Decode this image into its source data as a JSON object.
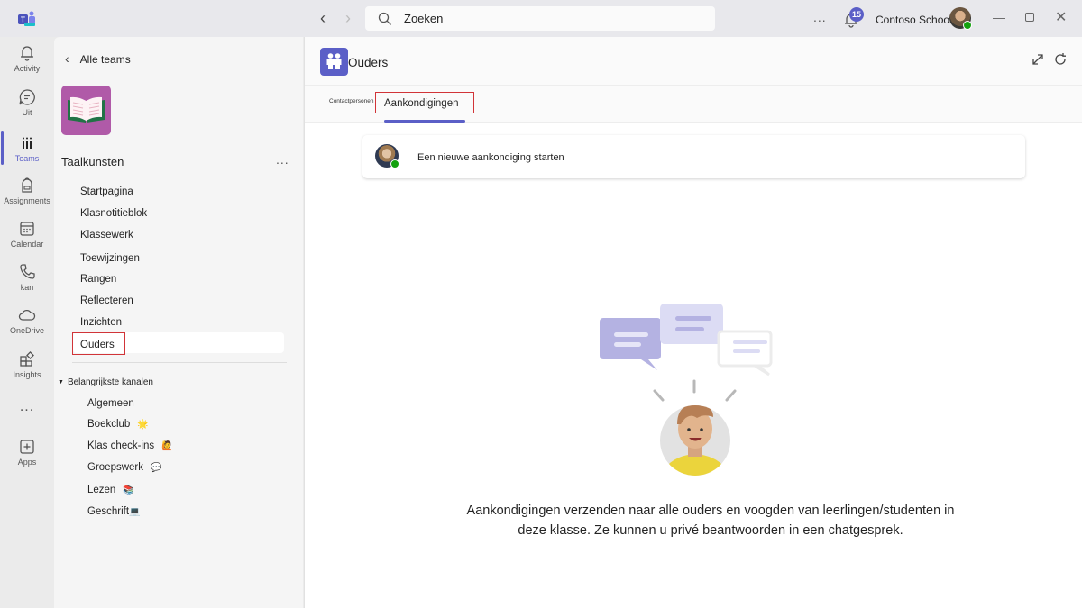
{
  "titlebar": {
    "search_placeholder": "Zoeken",
    "notification_count": "15",
    "org_name": "Contoso Schools",
    "more_label": "..."
  },
  "rail": {
    "items": [
      {
        "label": "Activity",
        "icon": "bell-icon"
      },
      {
        "label": "Uit",
        "icon": "chat-icon"
      },
      {
        "label": "Teams",
        "icon": "teams-icon",
        "active": true
      },
      {
        "label": "Assignments",
        "icon": "backpack-icon"
      },
      {
        "label": "Calendar",
        "icon": "calendar-icon"
      },
      {
        "label": "kan",
        "icon": "phone-icon"
      },
      {
        "label": "OneDrive",
        "icon": "cloud-icon"
      },
      {
        "label": "Insights",
        "icon": "insights-icon"
      },
      {
        "label": "...",
        "icon": "more-icon"
      },
      {
        "label": "Apps",
        "icon": "add-app-icon"
      }
    ],
    "accent": "#5b5fc7"
  },
  "team": {
    "back_label": "Alle teams",
    "name": "Taalkunsten",
    "more_label": "...",
    "nav": [
      "Startpagina",
      "Klasnotitieblok",
      "Klassewerk",
      "Toewijzingen",
      "Rangen",
      "Reflecteren",
      "Inzichten",
      "Ouders"
    ],
    "selected": "Ouders",
    "section_title": "Belangrijkste kanalen",
    "channels": [
      {
        "name": "Algemeen",
        "emoji": ""
      },
      {
        "name": "Boekclub",
        "emoji": "🌟"
      },
      {
        "name": "Klas check-ins",
        "emoji": "🙋"
      },
      {
        "name": "Groepswerk",
        "emoji": "💬"
      },
      {
        "name": "Lezen",
        "emoji": "📚"
      },
      {
        "name": "Geschrift",
        "emoji": "💻"
      }
    ]
  },
  "main": {
    "title": "Ouders",
    "tabs": [
      {
        "label": "Contactpersonen"
      },
      {
        "label": "Aankondigingen",
        "active": true
      }
    ],
    "compose_label": "Een nieuwe aankondiging starten",
    "empty_message": "Aankondigingen verzenden naar alle ouders en voogden van leerlingen/studenten in deze klasse. Ze kunnen u privé beantwoorden in een chatgesprek.",
    "highlight_color": "#d13438"
  }
}
